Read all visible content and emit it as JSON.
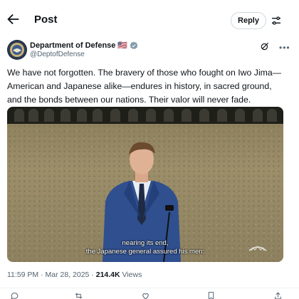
{
  "header": {
    "title": "Post",
    "reply_label": "Reply"
  },
  "author": {
    "name": "Department of Defense",
    "flag": "🇺🇸",
    "handle": "@DeptofDefense"
  },
  "post": {
    "text": "We have not forgotten. The bravery of those who fought on Iwo Jima—American and Japanese alike—endures in history, in sacred ground, and the bonds between our nations. Their valor will never fade."
  },
  "media": {
    "caption_line1": "nearing its end,",
    "caption_line2": "the Japanese general assured his men:"
  },
  "meta": {
    "time": "11:59 PM",
    "date": "Mar 28, 2025",
    "views_count": "214.4K",
    "views_label": "Views"
  },
  "colors": {
    "text": "#0f1419",
    "muted": "#536471",
    "verified": "#829aab",
    "border": "#cfd9de"
  },
  "icons": {
    "back": "arrow-left-icon",
    "tune": "tune-icon",
    "grok": "grok-icon",
    "more": "more-icon",
    "verified": "verified-badge-icon",
    "reply": "reply-icon",
    "repost": "repost-icon",
    "like": "like-icon",
    "bookmark": "bookmark-icon"
  }
}
